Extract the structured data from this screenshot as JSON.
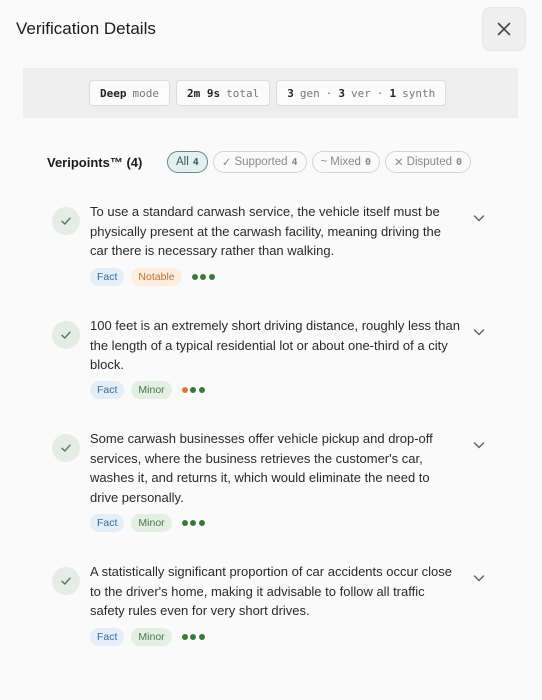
{
  "header": {
    "title": "Verification Details",
    "close_icon": "close-icon"
  },
  "stats": [
    {
      "value": "Deep",
      "label": "mode"
    },
    {
      "value": "2m 9s",
      "label": "total"
    }
  ],
  "counts": {
    "gen_value": "3",
    "gen_label": "gen",
    "sep1": "·",
    "ver_value": "3",
    "ver_label": "ver",
    "sep2": "·",
    "synth_value": "1",
    "synth_label": "synth"
  },
  "section": {
    "title": "Veripoints™ (4)"
  },
  "filters": [
    {
      "prefix": "",
      "label": "All",
      "count": "4",
      "active": true
    },
    {
      "prefix": "✓",
      "label": "Supported",
      "count": "4"
    },
    {
      "prefix": "~",
      "label": "Mixed",
      "count": "0"
    },
    {
      "prefix": "✕",
      "label": "Disputed",
      "count": "0"
    }
  ],
  "claims": [
    {
      "text": "To use a standard carwash service, the vehicle itself must be physically present at the carwash facility, meaning driving the car there is necessary rather than walking.",
      "type": "Fact",
      "importance": "Notable",
      "dot_colors": [
        "#3a7a3c",
        "#3a7a3c",
        "#3a7a3c"
      ]
    },
    {
      "text": "100 feet is an extremely short driving distance, roughly less than the length of a typical residential lot or about one-third of a city block.",
      "type": "Fact",
      "importance": "Minor",
      "dot_colors": [
        "#e07a2a",
        "#3a7a3c",
        "#3a7a3c"
      ]
    },
    {
      "text": "Some carwash businesses offer vehicle pickup and drop-off services, where the business retrieves the customer's car, washes it, and returns it, which would eliminate the need to drive personally.",
      "type": "Fact",
      "importance": "Minor",
      "dot_colors": [
        "#3a7a3c",
        "#3a7a3c",
        "#3a7a3c"
      ]
    },
    {
      "text": "A statistically significant proportion of car accidents occur close to the driver's home, making it advisable to follow all traffic safety rules even for very short drives.",
      "type": "Fact",
      "importance": "Minor",
      "dot_colors": [
        "#3a7a3c",
        "#3a7a3c",
        "#3a7a3c"
      ]
    }
  ]
}
